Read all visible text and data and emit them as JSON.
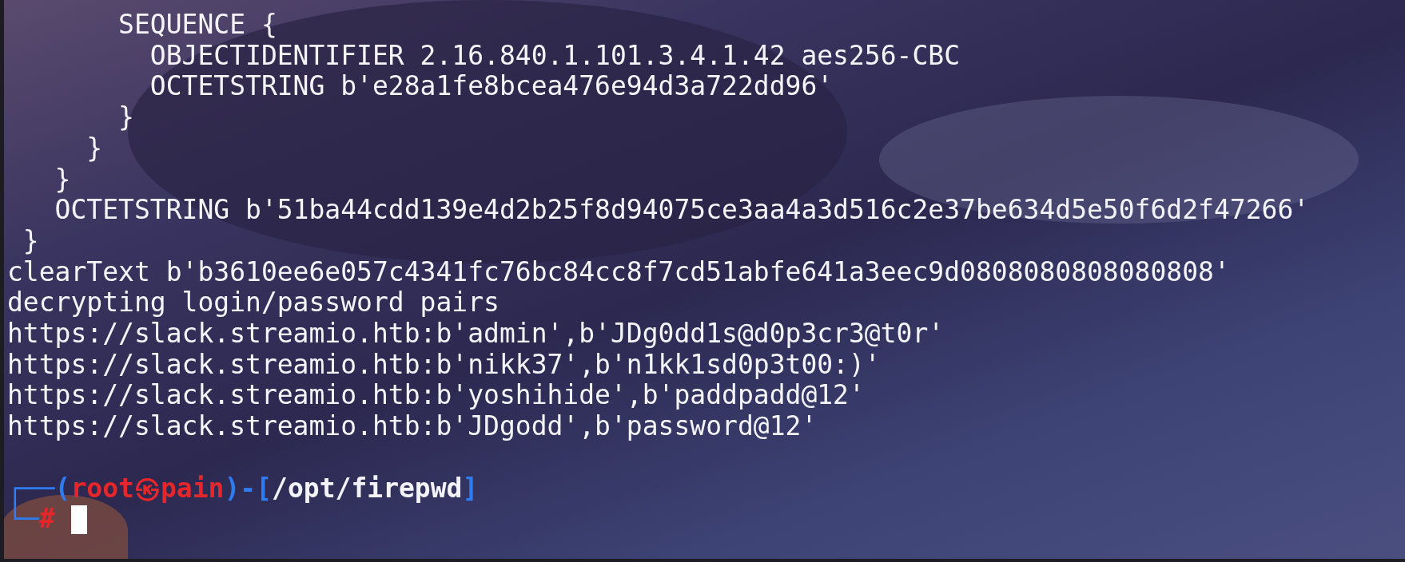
{
  "output_lines": [
    "       SEQUENCE {",
    "         OBJECTIDENTIFIER 2.16.840.1.101.3.4.1.42 aes256-CBC",
    "         OCTETSTRING b'e28a1fe8bcea476e94d3a722dd96'",
    "       }",
    "     }",
    "   }",
    "   OCTETSTRING b'51ba44cdd139e4d2b25f8d94075ce3aa4a3d516c2e37be634d5e50f6d2f47266'",
    " }",
    "clearText b'b3610ee6e057c4341fc76bc84cc8f7cd51abfe641a3eec9d0808080808080808'",
    "decrypting login/password pairs",
    "https://slack.streamio.htb:b'admin',b'JDg0dd1s@d0p3cr3@t0r'",
    "https://slack.streamio.htb:b'nikk37',b'n1kk1sd0p3t00:)'",
    "https://slack.streamio.htb:b'yoshihide',b'paddpadd@12'",
    "https://slack.streamio.htb:b'JDgodd',b'password@12'"
  ],
  "prompt": {
    "corner_top": "┌──(",
    "user": "root",
    "at": "㉿",
    "host": "pain",
    "separator": ")-[",
    "path": "/opt/firepwd",
    "close": "]",
    "corner_bottom": "└─",
    "symbol": "#"
  }
}
